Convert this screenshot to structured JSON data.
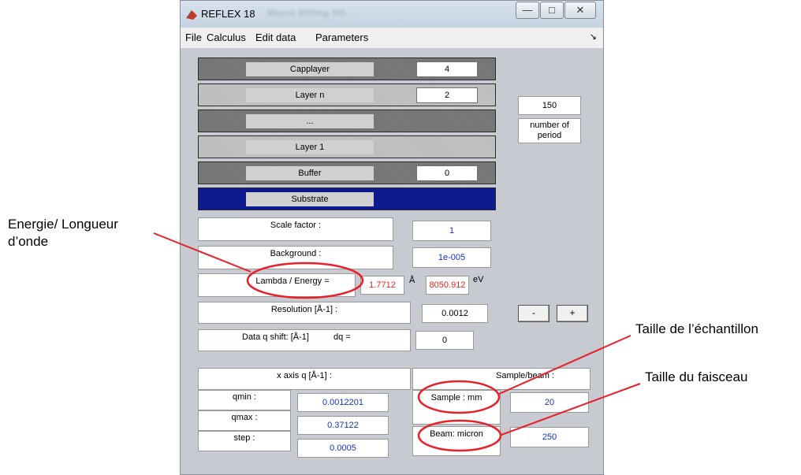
{
  "annotations": {
    "energy_line1": "Energie/ Longueur",
    "energy_line2": "d’onde",
    "sample_size": "Taille de l’échantillon",
    "beam_size": "Taille du faisceau"
  },
  "window": {
    "title": "REFLEX 18",
    "blurred_title_text": "Mount 600mg 5th...",
    "minimize_icon": "minimize-icon",
    "maximize_icon": "maximize-icon",
    "close_icon": "close-icon"
  },
  "menu": {
    "items": [
      "File",
      "Calculus",
      "Edit data",
      "Parameters"
    ],
    "dock_arrow": "↘"
  },
  "stack": {
    "capplayer": {
      "label": "Capplayer",
      "value": "4"
    },
    "layer_n": {
      "label": "Layer n",
      "value": "2"
    },
    "ellipsis": {
      "label": "..."
    },
    "layer_1": {
      "label": "Layer 1"
    },
    "buffer": {
      "label": "Buffer",
      "value": "0"
    },
    "substrate": {
      "label": "Substrate"
    },
    "periods": {
      "value": "150",
      "label": "number of period"
    }
  },
  "params": {
    "scale_factor": {
      "label": "Scale factor :",
      "value": "1"
    },
    "background": {
      "label": "Background :",
      "value": "1e-005"
    },
    "lambda_energy": {
      "label": "Lambda / Energy =",
      "lambda": "1.7712",
      "lambda_unit": "Å",
      "energy": "8050.912",
      "energy_unit": "eV"
    },
    "resolution": {
      "label": "Resolution [Å-1] :",
      "value": "0.0012",
      "minus": "-",
      "plus": "+"
    },
    "q_shift": {
      "label": "Data q shift: [Å-1]",
      "dq_label": "dq =",
      "value": "0"
    }
  },
  "xaxis": {
    "title": "x axis q [Å-1] :",
    "qmin": {
      "label": "qmin :",
      "value": "0.0012201"
    },
    "qmax": {
      "label": "qmax :",
      "value": "0.37122"
    },
    "step": {
      "label": "step :",
      "value": "0.0005"
    }
  },
  "sample_beam": {
    "title": "Sample/beam :",
    "sample": {
      "label": "Sample : mm",
      "value": "20"
    },
    "beam": {
      "label": "Beam: micron",
      "value": "250"
    }
  },
  "colors": {
    "annotation_red": "#e8202a",
    "value_blue": "#1432c8",
    "lambda_red": "#ff2020",
    "substrate_navy": "#0e1b8f"
  }
}
